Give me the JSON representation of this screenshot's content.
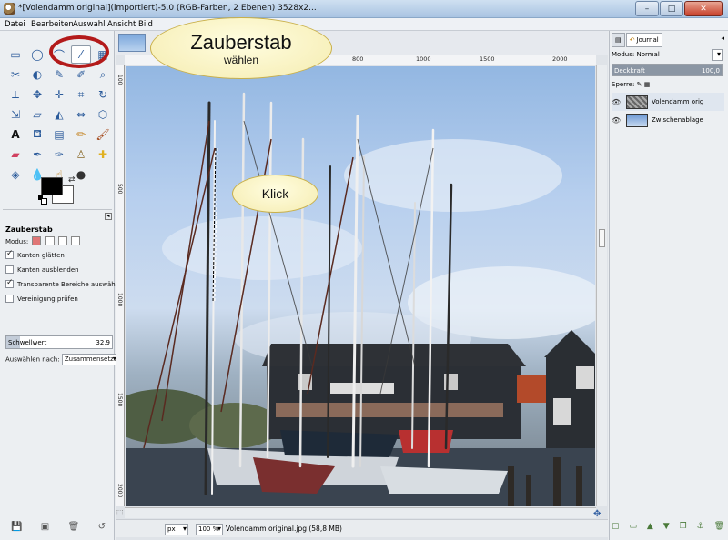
{
  "window": {
    "title": "*[Volendamm original](importiert)-5.0 (RGB-Farben, 2 Ebenen) 3528x2...",
    "buttons": [
      "–",
      "□",
      "✕"
    ]
  },
  "menubar": {
    "items": [
      "Datei",
      "Bearbeiten",
      "Auswahl",
      "Ansicht",
      "Bild"
    ]
  },
  "tool_options": {
    "title": "Zauberstab",
    "mode_label": "Modus:",
    "antialias": "Kanten glätten",
    "feather": "Kanten ausblenden",
    "transparent": "Transparente Bereiche auswählen",
    "sample_merged": "Vereinigung prüfen",
    "threshold_label": "Schwellwert",
    "threshold_value": "32,9",
    "threshold_fraction": 0.13,
    "select_by_label": "Auswählen nach:",
    "select_by_value": "Zusammensetzung"
  },
  "ruler": {
    "h_ticks": [
      "500",
      "800",
      "1000",
      "1500",
      "2000",
      "2500"
    ],
    "v_ticks": [
      "100",
      "500",
      "1000",
      "1500",
      "2000"
    ]
  },
  "status": {
    "unit": "px",
    "zoom": "100 %",
    "info": "Volendamm original.jpg (58,8 MB)"
  },
  "dock": {
    "tab_journal": "Journal",
    "mode_label": "Modus:",
    "mode_value": "Normal",
    "opacity_label": "Deckkraft",
    "opacity_value": "100,0",
    "lock_label": "Sperre:",
    "layers": [
      {
        "name": "Volendamm orig"
      },
      {
        "name": "Zwischenablage"
      }
    ]
  },
  "callouts": {
    "main_line1": "Zauberstab",
    "main_line2": "wählen",
    "click": "Klick"
  },
  "colors": {
    "accent": "#b31a1a",
    "callout_fill": "#fbf4c4"
  }
}
